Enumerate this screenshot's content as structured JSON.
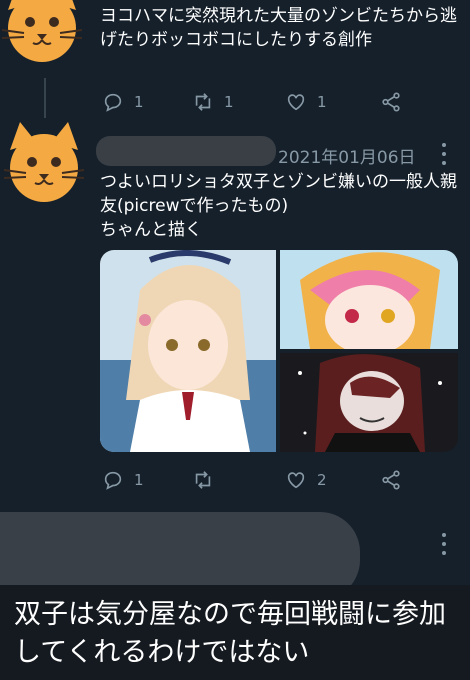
{
  "tweet1": {
    "text": "ヨコハマに突然現れた大量のゾンビたちから逃げたりボッコボコにしたりする創作",
    "replies": "1",
    "retweets": "1",
    "likes": "1"
  },
  "tweet2": {
    "date": "2021年01月06日",
    "text": "つよいロリショタ双子とゾンビ嫌いの一般人親友(picrewで作ったもの)\nちゃんと描く",
    "replies": "1",
    "retweets": "",
    "likes": "2"
  },
  "caption": "双子は気分屋なので毎回戦闘に参加してくれるわけではない",
  "colors": {
    "background": "#15202b",
    "muted": "#8899a6",
    "avatar": "#f4a942"
  },
  "icons": [
    "cat-avatar-icon",
    "reply-icon",
    "retweet-icon",
    "like-icon",
    "share-icon",
    "more-icon"
  ]
}
